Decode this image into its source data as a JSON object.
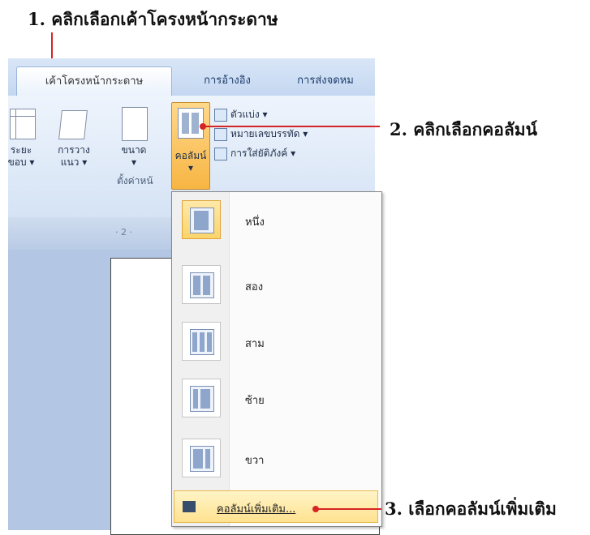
{
  "annotations": {
    "step1": "1. คลิกเลือกเค้าโครงหน้ากระดาษ",
    "step2": "2. คลิกเลือกคอลัมน์",
    "step3": "3. เลือกคอลัมน์เพิ่มเติม"
  },
  "ribbon": {
    "tabs": [
      {
        "label": "เค้าโครงหน้ากระดาษ",
        "active": true
      },
      {
        "label": "การอ้างอิง",
        "active": false
      },
      {
        "label": "การส่งจดหม",
        "active": false
      }
    ],
    "buttons": {
      "margins": {
        "line1": "ระยะ",
        "line2": "ขอบ ▾"
      },
      "orientation": {
        "line1": "การวาง",
        "line2": "แนว ▾"
      },
      "size": {
        "line1": "ขนาด",
        "line2": "▾"
      },
      "columns": {
        "line1": "คอลัมน์",
        "line2": "▾"
      }
    },
    "small_items": {
      "breaks": "ตัวแบ่ง ▾",
      "line_numbers": "หมายเลขบรรทัด ▾",
      "hyphenation": "การใส่ยัติภังค์ ▾"
    },
    "group_label": "ตั้งค่าหน้"
  },
  "ruler": {
    "text": "· 2 ·"
  },
  "dropdown": {
    "items": [
      {
        "label": "หนึ่ง",
        "icon": "one-column-icon",
        "selected": true
      },
      {
        "label": "สอง",
        "icon": "two-columns-icon",
        "selected": false
      },
      {
        "label": "สาม",
        "icon": "three-columns-icon",
        "selected": false
      },
      {
        "label": "ซ้าย",
        "icon": "left-column-icon",
        "selected": false
      },
      {
        "label": "ขวา",
        "icon": "right-column-icon",
        "selected": false
      }
    ],
    "more_columns": "คอลัมน์เพิ่มเติม..."
  },
  "colors": {
    "annotation_red": "#d62424",
    "highlight_orange": "#f7b543",
    "ribbon_blue": "#d5e3f5"
  }
}
